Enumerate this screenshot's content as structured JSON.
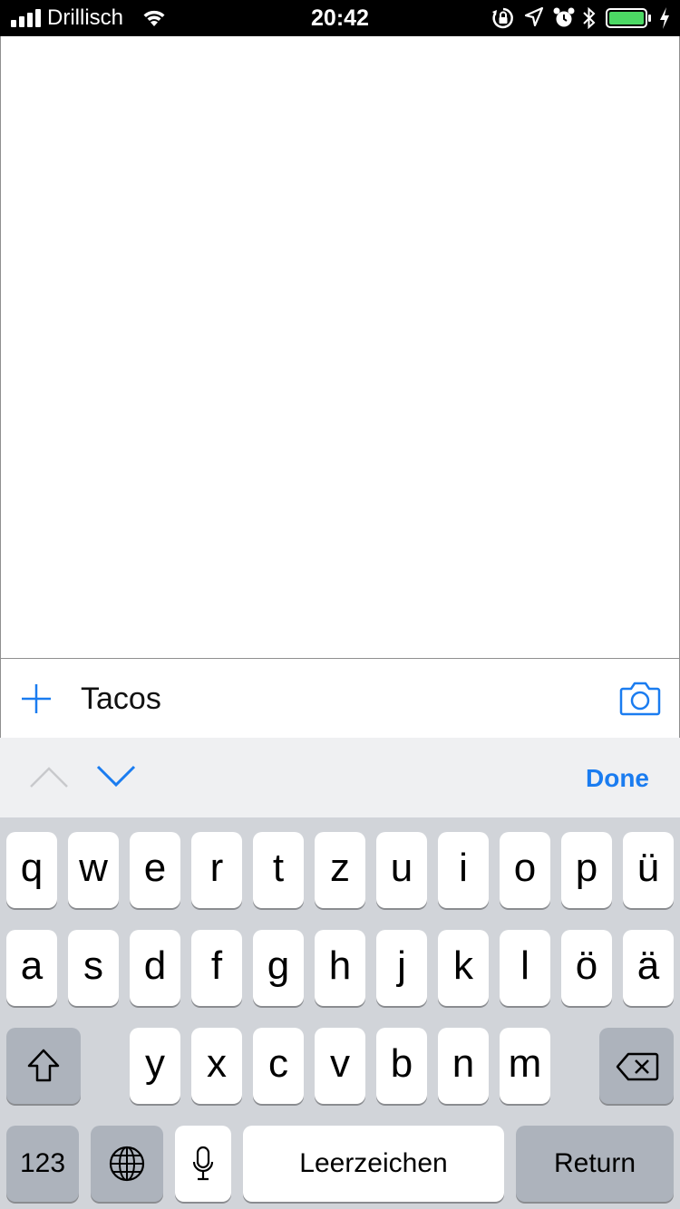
{
  "status_bar": {
    "carrier": "Drillisch",
    "time": "20:42",
    "icons": [
      "signal-bars-icon",
      "wifi-icon",
      "rotation-lock-icon",
      "location-arrow-icon",
      "alarm-icon",
      "bluetooth-icon",
      "battery-icon",
      "charging-bolt-icon"
    ],
    "battery_color": "#4cd964"
  },
  "input_bar": {
    "value": "Tacos",
    "add_icon": "plus-icon",
    "camera_icon": "camera-icon",
    "accent_color": "#1a7cf0"
  },
  "accessory_bar": {
    "prev_icon": "chevron-up-icon",
    "next_icon": "chevron-down-icon",
    "done_label": "Done"
  },
  "keyboard": {
    "row1": [
      "q",
      "w",
      "e",
      "r",
      "t",
      "z",
      "u",
      "i",
      "o",
      "p",
      "ü"
    ],
    "row2": [
      "a",
      "s",
      "d",
      "f",
      "g",
      "h",
      "j",
      "k",
      "l",
      "ö",
      "ä"
    ],
    "row3": [
      "y",
      "x",
      "c",
      "v",
      "b",
      "n",
      "m"
    ],
    "numbers_label": "123",
    "space_label": "Leerzeichen",
    "return_label": "Return",
    "shift_icon": "shift-icon",
    "delete_icon": "backspace-icon",
    "globe_icon": "globe-icon",
    "mic_icon": "microphone-icon"
  }
}
